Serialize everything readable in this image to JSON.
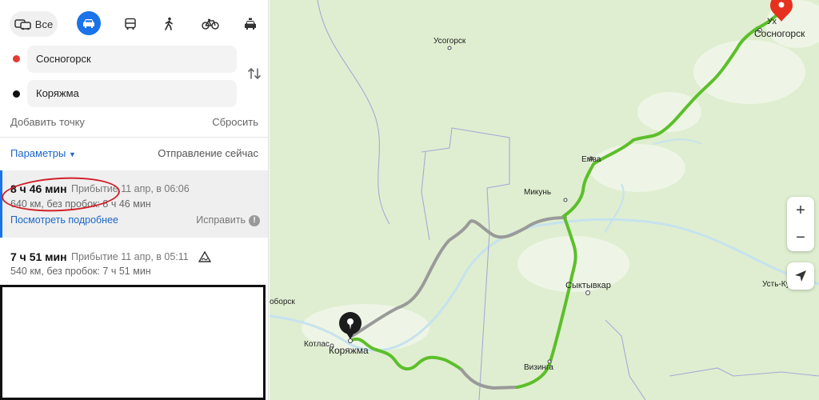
{
  "modes": {
    "all_label": "Все",
    "items": [
      "all-transport-icon",
      "car-icon",
      "bus-icon",
      "walk-icon",
      "bike-icon",
      "taxi-icon"
    ],
    "selected": "car",
    "selected_color": "#1a73e8"
  },
  "from": {
    "value": "Сосногорск",
    "dot_color": "#e53935"
  },
  "to": {
    "value": "Коряжма",
    "dot_color": "#111111"
  },
  "add_point": "Добавить точку",
  "reset": "Сбросить",
  "params_label": "Параметры",
  "departure": "Отправление сейчас",
  "routes": [
    {
      "time": "8 ч 46 мин",
      "arrival": "Прибытие 11 апр, в 06:06",
      "distance": "640 км, без пробок: 8 ч 46 мин",
      "details_link": "Посмотреть подробнее",
      "fix_label": "Исправить",
      "selected": true
    },
    {
      "time": "7 ч 51 мин",
      "arrival": "Прибытие 11 апр, в 05:11",
      "distance": "540 км, без пробок: 7 ч 51 мин",
      "selected": false
    }
  ],
  "map": {
    "cities": {
      "sosnogorsk": "Сосногорск",
      "usogorsk": "Усогорск",
      "emva": "Емва",
      "mikun": "Микунь",
      "syktyvkar": "Сыктывкар",
      "ust_kulom": "Усть-Кулом",
      "koryazhma": "Коряжма",
      "kotlas": "Котлас",
      "vizinga": "Визинга",
      "vychegodsky": "оборск",
      "ukhta": "Ух"
    },
    "zoom_in": "+",
    "zoom_out": "−",
    "route_color": "#5cbf2a",
    "alt_route_color": "#9a9a9a",
    "water_color": "#c6e2ee",
    "land_color": "#dfeed0"
  }
}
